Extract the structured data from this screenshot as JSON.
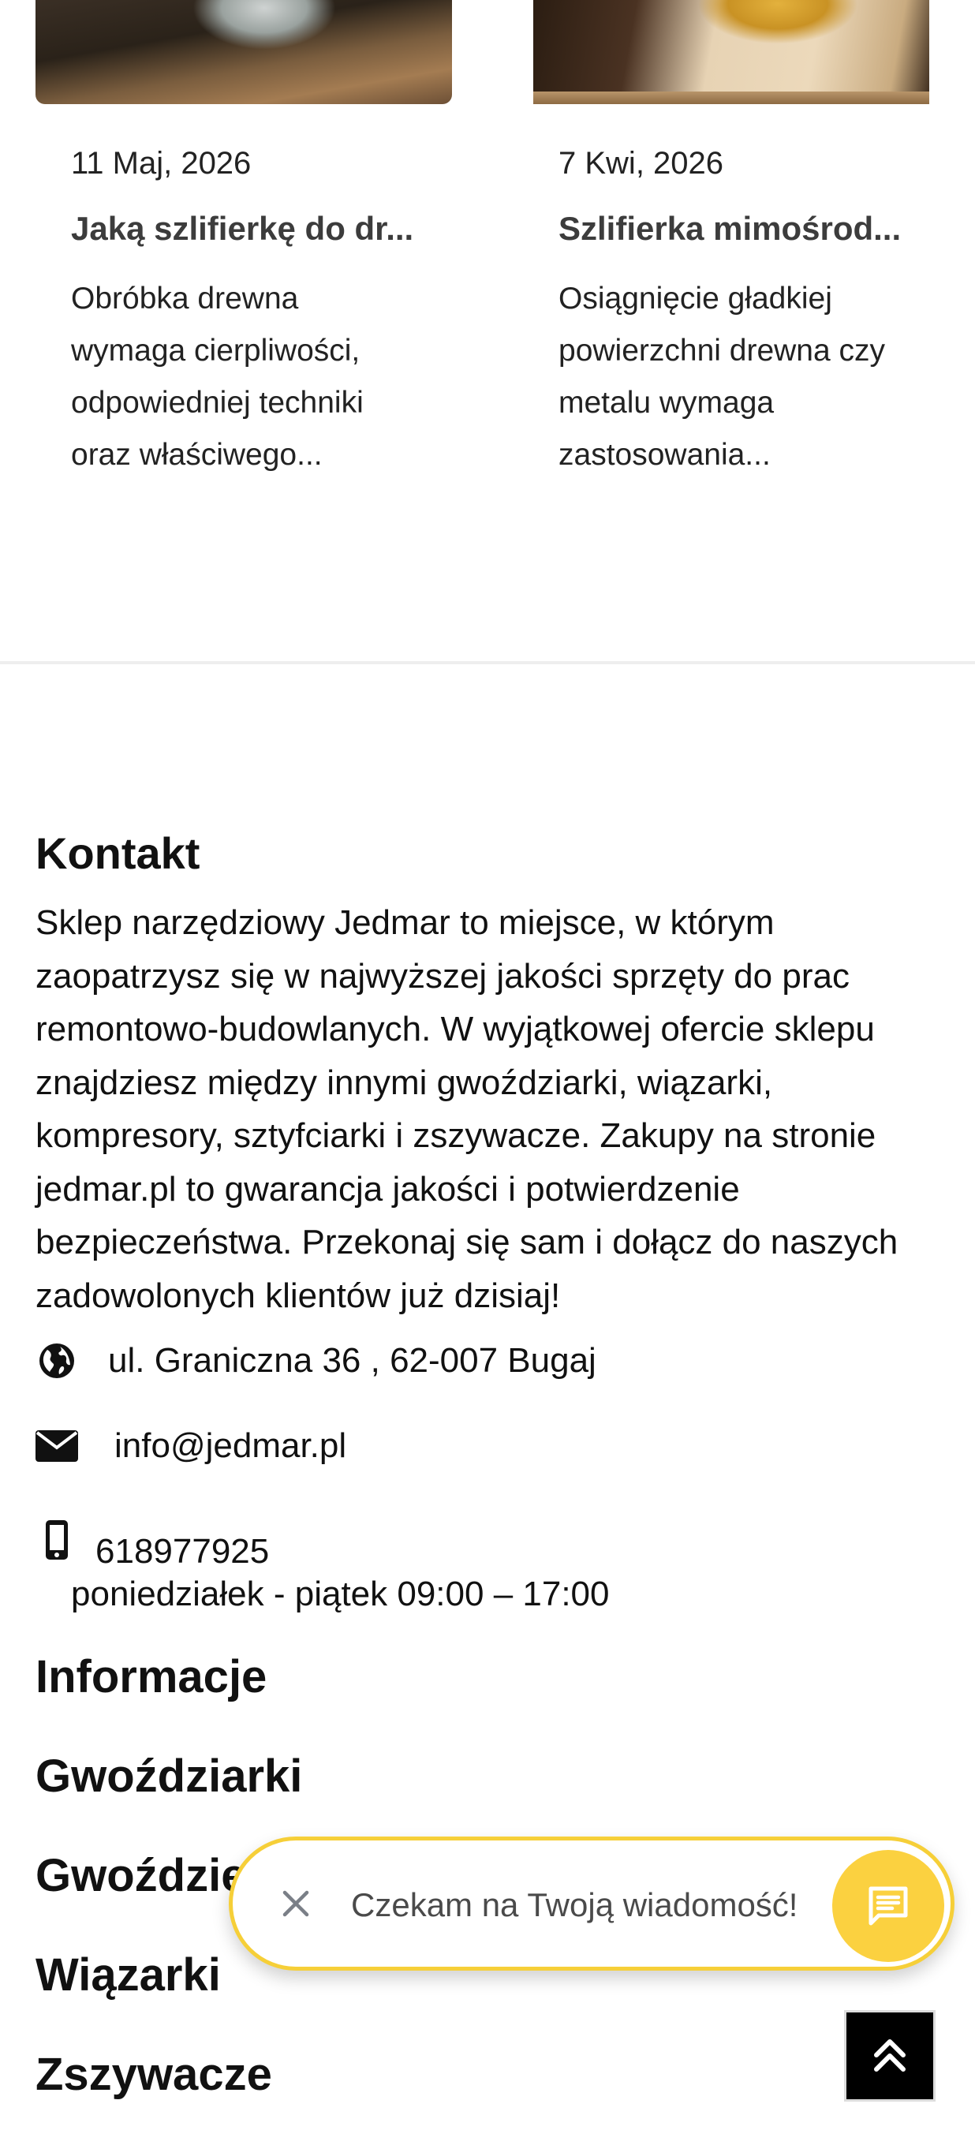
{
  "blog": {
    "posts": [
      {
        "date": "11 Maj, 2026",
        "title": "Jaką szlifierkę do dr...",
        "excerpt": "Obróbka drewna wymaga cierpliwości, odpowiedniej techniki oraz właściwego..."
      },
      {
        "date": "7 Kwi, 2026",
        "title": "Szlifierka mimośrod...",
        "excerpt": "Osiągnięcie gładkiej powierzchni drewna czy metalu wymaga zastosowania..."
      }
    ]
  },
  "contact": {
    "heading": "Kontakt",
    "description": "Sklep narzędziowy Jedmar to miejsce, w którym zaopatrzysz się w najwyższej jakości sprzęty do prac remontowo-budowlanych. W wyjątkowej ofercie sklepu znajdziesz między innymi gwoździarki, wiązarki, kompresory, sztyfciarki i zszywacze. Zakupy na stronie jedmar.pl to gwarancja jakości i potwierdzenie bezpieczeństwa. Przekonaj się sam i dołącz do naszych zadowolonych klientów już dzisiaj!",
    "address": "ul. Graniczna 36 , 62-007 Bugaj",
    "email": "info@jedmar.pl",
    "phone": "618977925",
    "hours": "poniedziałek - piątek 09:00 – 17:00",
    "icons": {
      "address": "globe-icon",
      "email": "envelope-icon",
      "phone": "mobile-phone-icon"
    }
  },
  "footer": {
    "links": [
      "Informacje",
      "Gwoździarki",
      "Gwoździe",
      "Wiązarki",
      "Zszywacze"
    ]
  },
  "chat": {
    "message": "Czekam na Twoją wiadomość!",
    "close_icon": "close-icon",
    "button_icon": "chat-message-icon",
    "accent_color": "#fbd140"
  },
  "scroll_top": {
    "icon": "double-chevron-up-icon"
  }
}
